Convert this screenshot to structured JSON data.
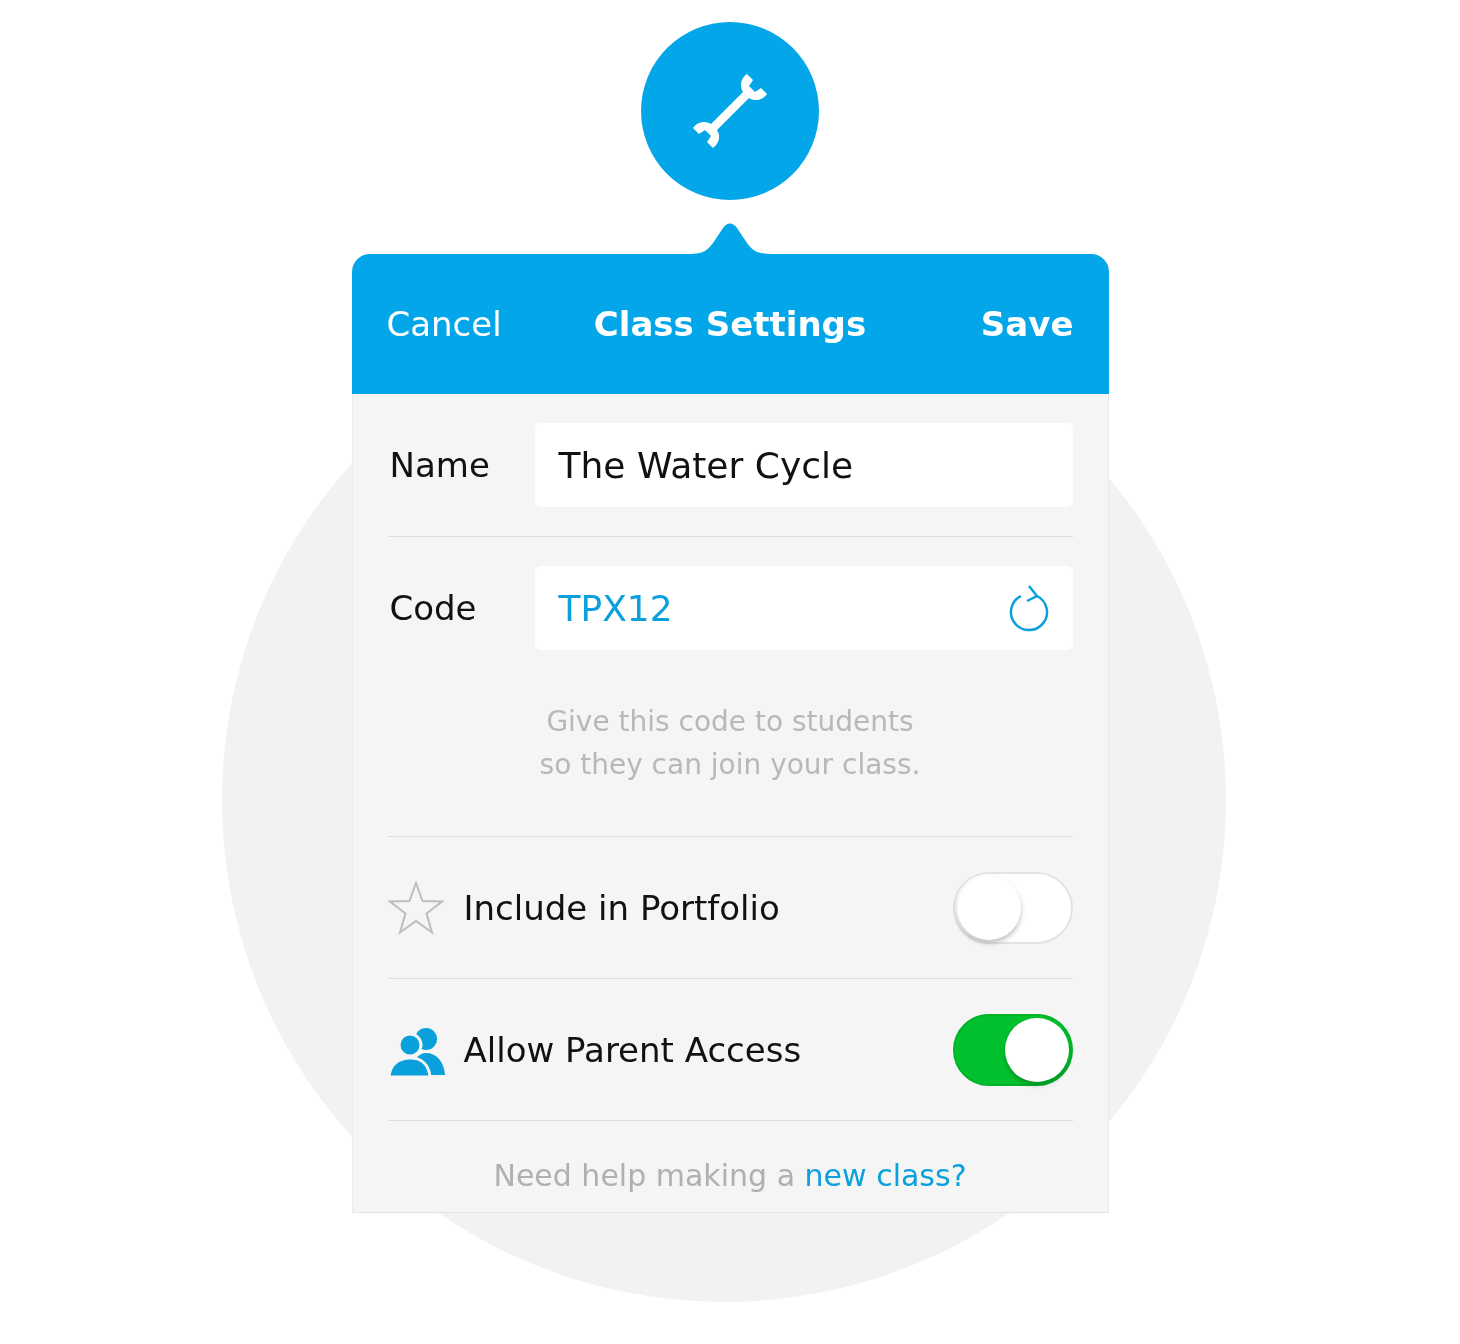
{
  "header": {
    "cancel": "Cancel",
    "title": "Class Settings",
    "save": "Save"
  },
  "fields": [
    {
      "kind": "text",
      "label": "Name",
      "value": "The Water Cycle"
    },
    {
      "kind": "code",
      "label": "Code",
      "value": "TPX12"
    }
  ],
  "hint_lines": [
    "Give this code to students",
    "so they can join your class."
  ],
  "toggles": [
    {
      "kind": "star",
      "label": "Include in Portfolio",
      "on": false
    },
    {
      "kind": "parents",
      "label": "Allow Parent Access",
      "on": true
    }
  ],
  "footer": {
    "text": "Need help making a",
    "link": "new class?"
  }
}
